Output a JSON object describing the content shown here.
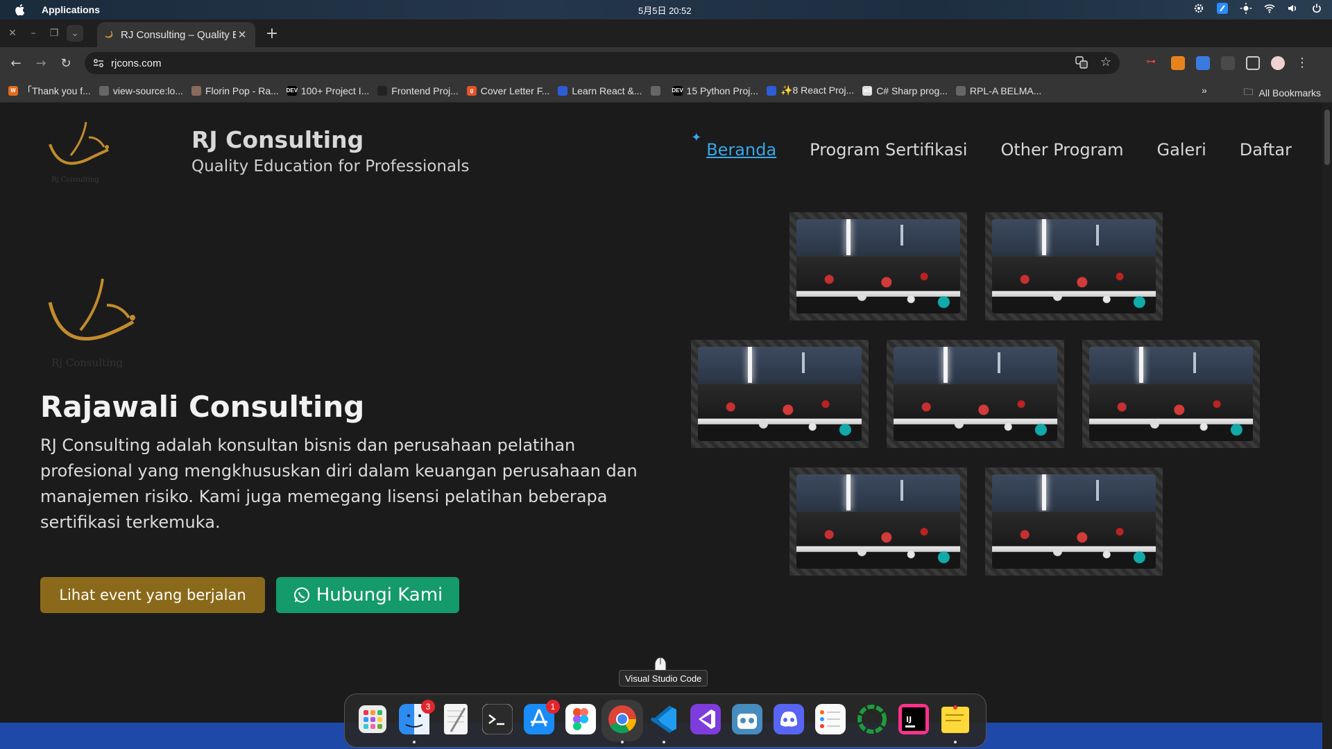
{
  "menubar": {
    "app_name": "Applications",
    "clock": "5月5日  20:52"
  },
  "browser": {
    "tab_title": "RJ Consulting – Quality Education for Professionals",
    "url": "rjcons.com",
    "bookmarks": [
      {
        "label": "「Thank you f...",
        "color": "#e06b1f",
        "glyph": "W"
      },
      {
        "label": "view-source:lo...",
        "color": "#666",
        "glyph": ""
      },
      {
        "label": "Florin Pop - Ra...",
        "color": "#8a6a5a",
        "glyph": ""
      },
      {
        "label": "100+ Project I...",
        "color": "#000",
        "glyph": "DEV"
      },
      {
        "label": "Frontend Proj...",
        "color": "#222",
        "glyph": ""
      },
      {
        "label": "Cover Letter F...",
        "color": "#e6532c",
        "glyph": "g"
      },
      {
        "label": "Learn React &...",
        "color": "#2d5cd6",
        "glyph": ""
      },
      {
        "label": "",
        "color": "#666",
        "glyph": ""
      },
      {
        "label": "15 Python Proj...",
        "color": "#000",
        "glyph": "DEV"
      },
      {
        "label": "✨8 React Proj...",
        "color": "#2d5cd6",
        "glyph": ""
      },
      {
        "label": "C# Sharp prog...",
        "color": "#ddd",
        "glyph": "w3"
      },
      {
        "label": "RPL-A BELMA...",
        "color": "#666",
        "glyph": ""
      }
    ],
    "all_bookmarks": "All Bookmarks"
  },
  "site": {
    "brand_name": "RJ Consulting",
    "brand_tagline": "Quality Education for Professionals",
    "logo_caption": "Rj Consulting",
    "nav": [
      {
        "label": "Beranda",
        "active": true
      },
      {
        "label": "Program Sertifikasi",
        "active": false
      },
      {
        "label": "Other Program",
        "active": false
      },
      {
        "label": "Galeri",
        "active": false
      },
      {
        "label": "Daftar",
        "active": false
      }
    ],
    "hero": {
      "title": "Rajawali Consulting",
      "text": "RJ Consulting adalah konsultan bisnis dan perusahaan pelatihan profesional yang mengkhususkan diri dalam keuangan perusahaan dan manajemen risiko. Kami juga memegang lisensi pelatihan beberapa sertifikasi terkemuka.",
      "btn_events": "Lihat event yang berjalan",
      "btn_contact": "Hubungi Kami"
    },
    "gallery_count": 7
  },
  "dock": {
    "tooltip": "Visual Studio Code",
    "apps": [
      {
        "name": "launchpad-icon",
        "badge": ""
      },
      {
        "name": "finder-icon",
        "badge": "3"
      },
      {
        "name": "textedit-icon",
        "badge": ""
      },
      {
        "name": "terminal-icon",
        "badge": ""
      },
      {
        "name": "app-store-icon",
        "badge": "1"
      },
      {
        "name": "figma-icon",
        "badge": ""
      },
      {
        "name": "chrome-icon",
        "badge": ""
      },
      {
        "name": "vscode-icon",
        "badge": ""
      },
      {
        "name": "visual-studio-icon",
        "badge": ""
      },
      {
        "name": "godot-icon",
        "badge": ""
      },
      {
        "name": "discord-icon",
        "badge": ""
      },
      {
        "name": "reminders-icon",
        "badge": ""
      },
      {
        "name": "activity-ring-icon",
        "badge": ""
      },
      {
        "name": "intellij-icon",
        "badge": ""
      },
      {
        "name": "stickies-icon",
        "badge": ""
      }
    ]
  },
  "colors": {
    "accent_nav": "#38a7e8",
    "btn_events": "#8a6a1a",
    "btn_contact": "#149a6b",
    "footer": "#1e49a8"
  }
}
